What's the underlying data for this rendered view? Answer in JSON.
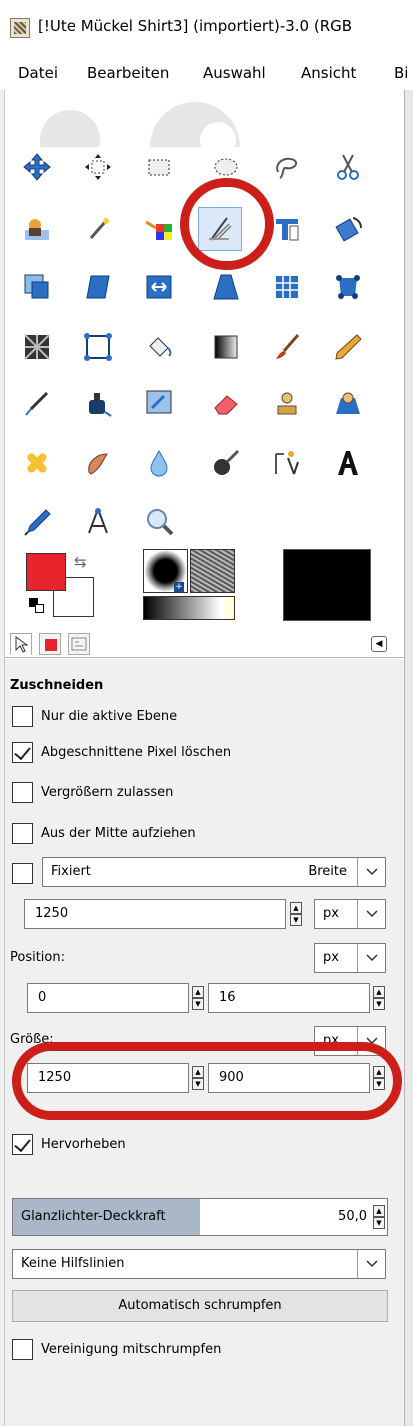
{
  "window": {
    "title": "[!Ute Mückel Shirt3] (importiert)-3.0 (RGB"
  },
  "menubar": {
    "items": [
      "Datei",
      "Bearbeiten",
      "Auswahl",
      "Ansicht",
      "Bi"
    ]
  },
  "toolbox": {
    "tools": [
      "move-icon",
      "align-icon",
      "rect-select-icon",
      "ellipse-select-icon",
      "free-select-icon",
      "scissors-select-icon",
      "foreground-select-icon",
      "fuzzy-select-icon",
      "color-select-icon",
      "crop-icon",
      "unified-transform-icon",
      "rotate-icon",
      "scale-icon",
      "shear-icon",
      "flip-icon",
      "perspective-icon",
      "cage-transform-icon",
      "warp-transform-icon",
      "paths-icon",
      "handle-transform-icon",
      "bucket-fill-icon",
      "blend-icon",
      "paintbrush-icon",
      "pencil-icon",
      "airbrush-icon",
      "ink-icon",
      "mypaint-brush-icon",
      "eraser-icon",
      "clone-icon",
      "perspective-clone-icon",
      "heal-icon",
      "smudge-icon",
      "blur-icon",
      "dodge-burn-icon",
      "text-path-icon",
      "text-icon",
      "color-picker-icon",
      "measure-icon",
      "zoom-icon"
    ],
    "active_tool": "crop-icon"
  },
  "colors": {
    "foreground": "#e8232b",
    "background": "#ffffff",
    "accent_red": "#cc1f1a"
  },
  "options": {
    "title": "Zuschneiden",
    "only_active_layer": {
      "label": "Nur die aktive Ebene",
      "checked": false
    },
    "delete_cropped": {
      "label": "Abgeschnittene Pixel löschen",
      "checked": true
    },
    "allow_growing": {
      "label": "Vergrößern zulassen",
      "checked": false
    },
    "expand_center": {
      "label": "Aus der Mitte aufziehen",
      "checked": false
    },
    "fixed": {
      "label": "Fixiert",
      "checked": false,
      "mode": "Breite"
    },
    "fixed_value": "1250",
    "fixed_unit": "px",
    "position": {
      "label": "Position:",
      "unit": "px",
      "x": "0",
      "y": "16"
    },
    "size": {
      "label": "Größe:",
      "unit": "px",
      "w": "1250",
      "h": "900"
    },
    "highlight": {
      "label": "Hervorheben",
      "checked": true
    },
    "highlight_opacity": {
      "label": "Glanzlichter-Deckkraft",
      "value": "50,0",
      "fraction": 0.5
    },
    "guides": "Keine Hilfslinien",
    "auto_shrink": "Automatisch schrumpfen",
    "shrink_merged": {
      "label": "Vereinigung mitschrumpfen",
      "checked": false
    }
  }
}
